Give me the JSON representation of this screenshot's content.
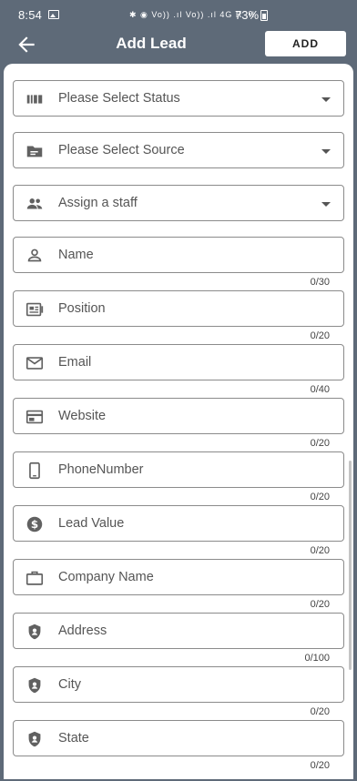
{
  "status_bar": {
    "time": "8:54",
    "network_icons": "✱ ◉ Vo)) .ıl Vo)) .ıl 4G R .ıl",
    "battery": "73%"
  },
  "appbar": {
    "title": "Add Lead",
    "add_label": "ADD"
  },
  "selects": [
    {
      "icon": "status-bars-icon",
      "label": "Please Select Status"
    },
    {
      "icon": "source-folder-icon",
      "label": "Please Select Source"
    },
    {
      "icon": "people-icon",
      "label": "Assign a staff"
    }
  ],
  "inputs": [
    {
      "icon": "person-icon",
      "placeholder": "Name",
      "counter": "0/30"
    },
    {
      "icon": "id-card-icon",
      "placeholder": "Position",
      "counter": "0/20"
    },
    {
      "icon": "mail-icon",
      "placeholder": "Email",
      "counter": "0/40"
    },
    {
      "icon": "browser-icon",
      "placeholder": "Website",
      "counter": "0/20"
    },
    {
      "icon": "phone-icon",
      "placeholder": "PhoneNumber",
      "counter": "0/20"
    },
    {
      "icon": "dollar-icon",
      "placeholder": "Lead Value",
      "counter": "0/20"
    },
    {
      "icon": "briefcase-icon",
      "placeholder": "Company Name",
      "counter": "0/20"
    },
    {
      "icon": "location-shield-icon",
      "placeholder": "Address",
      "counter": "0/100"
    },
    {
      "icon": "location-shield-icon",
      "placeholder": "City",
      "counter": "0/20"
    },
    {
      "icon": "location-shield-icon",
      "placeholder": "State",
      "counter": "0/20"
    }
  ]
}
